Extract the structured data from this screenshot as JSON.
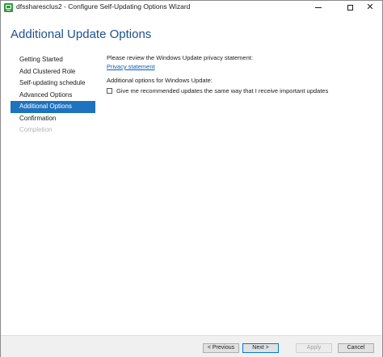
{
  "window": {
    "title": "dfssharesclus2 - Configure Self-Updating Options Wizard",
    "controls": {
      "minimize": "minimize",
      "maximize": "maximize",
      "close": "✕"
    }
  },
  "page": {
    "title": "Additional Update Options"
  },
  "nav": {
    "items": [
      {
        "label": "Getting Started",
        "state": "normal"
      },
      {
        "label": "Add Clustered Role",
        "state": "normal"
      },
      {
        "label": "Self-updating schedule",
        "state": "normal"
      },
      {
        "label": "Advanced Options",
        "state": "normal"
      },
      {
        "label": "Additional Options",
        "state": "active"
      },
      {
        "label": "Confirmation",
        "state": "normal"
      },
      {
        "label": "Completion",
        "state": "disabled"
      }
    ]
  },
  "content": {
    "privacy_prompt": "Please review the Windows Update privacy statement:",
    "privacy_link": "Privacy statement",
    "additional_label": "Additional options for Windows Update:",
    "recommended_checkbox": {
      "label": "Give me recommended updates the same way that I receive important updates",
      "checked": false
    }
  },
  "footer": {
    "previous_label": "< Previous",
    "next_label": "Next >",
    "apply_label": "Apply",
    "cancel_label": "Cancel"
  },
  "colors": {
    "accent": "#1e73be",
    "title_blue": "#1e4f8f",
    "link": "#0b5fb2",
    "disabled_text": "#b3b3b3"
  }
}
